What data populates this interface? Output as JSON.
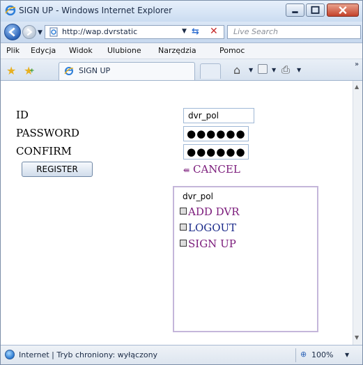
{
  "window": {
    "title": "SIGN UP - Windows Internet Explorer"
  },
  "address": {
    "url": "http://wap.dvrstatic",
    "search_placeholder": "Live Search"
  },
  "menu": {
    "items": [
      "Plik",
      "Edycja",
      "Widok",
      "Ulubione",
      "Narzędzia",
      "Pomoc"
    ]
  },
  "tabs": {
    "active_label": "SIGN UP"
  },
  "form": {
    "id_label": "ID",
    "password_label": "PASSWORD",
    "confirm_label": "CONFIRM",
    "id_value": "dvr_pol",
    "password_mask": "●●●●●●",
    "confirm_mask": "●●●●●●",
    "register_label": "REGISTER",
    "cancel_label": "CANCEL"
  },
  "panel": {
    "username": "dvr_pol",
    "links": [
      "ADD DVR",
      "LOGOUT",
      "SIGN UP"
    ]
  },
  "status": {
    "zone": "Internet | Tryb chroniony: wyłączony",
    "zoom": "100%"
  },
  "colors": {
    "link_purple": "#7a1a7a",
    "link_blue": "#1a2a8a",
    "panel_border": "#c4b6da"
  }
}
